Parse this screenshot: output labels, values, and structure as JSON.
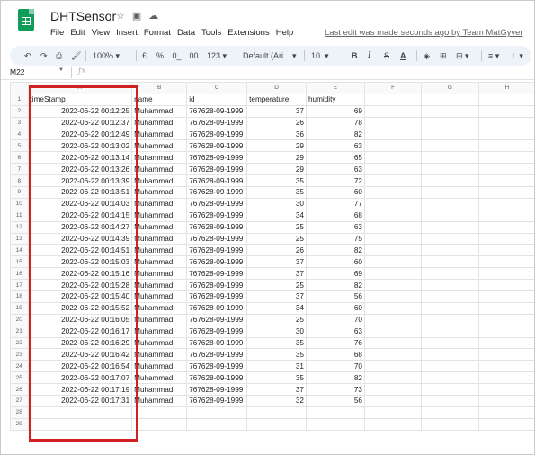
{
  "app": {
    "title": "DHTSensor",
    "menu": [
      "File",
      "Edit",
      "View",
      "Insert",
      "Format",
      "Data",
      "Tools",
      "Extensions",
      "Help"
    ],
    "last_edit": "Last edit was made seconds ago by Team MatGyver",
    "title_icons": [
      "star-icon",
      "move-to-folder-icon",
      "cloud-status-icon"
    ]
  },
  "toolbar": {
    "zoom": "100%",
    "currency": "£",
    "percent": "%",
    "decrease_decimal": ".0_",
    "increase_decimal": ".00",
    "more_formats": "123",
    "font": "Default (Ari...",
    "font_size": "10",
    "bold": "B",
    "italic": "I",
    "strikethrough": "S",
    "text_color": "A"
  },
  "formula_bar": {
    "name_box": "M22",
    "fx": "fx"
  },
  "columns": [
    "A",
    "B",
    "C",
    "D",
    "E",
    "F",
    "G",
    "H"
  ],
  "headers": [
    "timeStamp",
    "name",
    "id",
    "temperature",
    "humidity"
  ],
  "rows": [
    [
      "2022-06-22 00:12:25",
      "Muhammad",
      "767628-09-1999",
      "37",
      "69"
    ],
    [
      "2022-06-22 00:12:37",
      "Muhammad",
      "767628-09-1999",
      "26",
      "78"
    ],
    [
      "2022-06-22 00:12:49",
      "Muhammad",
      "767628-09-1999",
      "36",
      "82"
    ],
    [
      "2022-06-22 00:13:02",
      "Muhammad",
      "767628-09-1999",
      "29",
      "63"
    ],
    [
      "2022-06-22 00:13:14",
      "Muhammad",
      "767628-09-1999",
      "29",
      "65"
    ],
    [
      "2022-06-22 00:13:26",
      "Muhammad",
      "767628-09-1999",
      "29",
      "63"
    ],
    [
      "2022-06-22 00:13:39",
      "Muhammad",
      "767628-09-1999",
      "35",
      "72"
    ],
    [
      "2022-06-22 00:13:51",
      "Muhammad",
      "767628-09-1999",
      "35",
      "60"
    ],
    [
      "2022-06-22 00:14:03",
      "Muhammad",
      "767628-09-1999",
      "30",
      "77"
    ],
    [
      "2022-06-22 00:14:15",
      "Muhammad",
      "767628-09-1999",
      "34",
      "68"
    ],
    [
      "2022-06-22 00:14:27",
      "Muhammad",
      "767628-09-1999",
      "25",
      "63"
    ],
    [
      "2022-06-22 00:14:39",
      "Muhammad",
      "767628-09-1999",
      "25",
      "75"
    ],
    [
      "2022-06-22 00:14:51",
      "Muhammad",
      "767628-09-1999",
      "26",
      "82"
    ],
    [
      "2022-06-22 00:15:03",
      "Muhammad",
      "767628-09-1999",
      "37",
      "60"
    ],
    [
      "2022-06-22 00:15:16",
      "Muhammad",
      "767628-09-1999",
      "37",
      "69"
    ],
    [
      "2022-06-22 00:15:28",
      "Muhammad",
      "767628-09-1999",
      "25",
      "82"
    ],
    [
      "2022-06-22 00:15:40",
      "Muhammad",
      "767628-09-1999",
      "37",
      "56"
    ],
    [
      "2022-06-22 00:15:52",
      "Muhammad",
      "767628-09-1999",
      "34",
      "60"
    ],
    [
      "2022-06-22 00:16:05",
      "Muhammad",
      "767628-09-1999",
      "25",
      "70"
    ],
    [
      "2022-06-22 00:16:17",
      "Muhammad",
      "767628-09-1999",
      "30",
      "63"
    ],
    [
      "2022-06-22 00:16:29",
      "Muhammad",
      "767628-09-1999",
      "35",
      "76"
    ],
    [
      "2022-06-22 00:16:42",
      "Muhammad",
      "767628-09-1999",
      "35",
      "68"
    ],
    [
      "2022-06-22 00:16:54",
      "Muhammad",
      "767628-09-1999",
      "31",
      "70"
    ],
    [
      "2022-06-22 00:17:07",
      "Muhammad",
      "767628-09-1999",
      "35",
      "82"
    ],
    [
      "2022-06-22 00:17:19",
      "Muhammad",
      "767628-09-1999",
      "37",
      "73"
    ],
    [
      "2022-06-22 00:17:31",
      "Muhammad",
      "767628-09-1999",
      "32",
      "56"
    ]
  ],
  "extra_row_numbers": [
    "28",
    "29"
  ],
  "colors": {
    "highlight": "#d21f1f",
    "sheets_green": "#0f9d58",
    "toolbar_bg": "#eef2f9"
  }
}
